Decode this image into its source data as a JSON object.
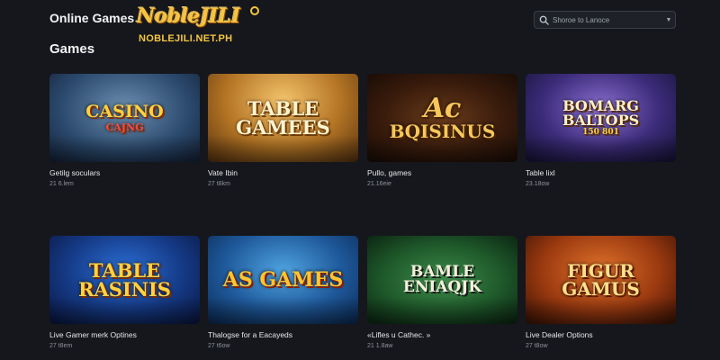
{
  "header": {
    "app_title": "Online Games",
    "logo": {
      "wordmark": "NobleJILI",
      "url": "NOBLEJILI.NET.PH"
    },
    "search": {
      "placeholder": "Shoroe to Lanoce",
      "icon": "search-icon",
      "dropdown_icon": "chevron-down-icon"
    }
  },
  "section": {
    "title": "Games"
  },
  "games": [
    {
      "thumb_text": "CASINO",
      "thumb_sub": "CAJNG",
      "title": "Getilg soculars",
      "meta": "21 6.lem"
    },
    {
      "thumb_text": "TABLE GAMEES",
      "title": "Vate Ibin",
      "meta": "27 t8km"
    },
    {
      "thumb_big": "Ac",
      "thumb_text": "BQISINUS",
      "title": "Pullo, games",
      "meta": "21.16eie"
    },
    {
      "thumb_text": "BOMARG BALTOPS",
      "thumb_sub": "150 801",
      "title": "Table lixl",
      "meta": "23.18ow"
    },
    {
      "thumb_text": "TABLE RASINIS",
      "title": "Live Gamer merk Optines",
      "meta": "27 t8em"
    },
    {
      "thumb_text": "AS GAMES",
      "title": "Thalogse for a Eacayeds",
      "meta": "27 t6ow"
    },
    {
      "thumb_text": "BAMLE ENIAQJK",
      "title": "«Lifles u Cathec. »",
      "meta": "21 1.8aw"
    },
    {
      "thumb_text": "FIGUR GAMUS",
      "title": "Live Dealer Options",
      "meta": "27 t8ow"
    }
  ],
  "colors": {
    "background": "#15171c",
    "accent": "#f5c542",
    "text": "#e8e8ea",
    "muted": "#8e929c"
  }
}
